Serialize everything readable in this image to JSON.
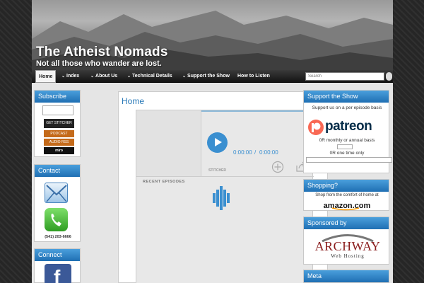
{
  "header": {
    "title": "The Atheist Nomads",
    "tagline": "Not all those who wander are lost."
  },
  "nav": {
    "items": [
      {
        "label": "Home",
        "active": true,
        "dropdown": false
      },
      {
        "label": "Index",
        "active": false,
        "dropdown": true
      },
      {
        "label": "About Us",
        "active": false,
        "dropdown": true
      },
      {
        "label": "Technical Details",
        "active": false,
        "dropdown": true
      },
      {
        "label": "Support the Show",
        "active": false,
        "dropdown": true
      },
      {
        "label": "How to Listen",
        "active": false,
        "dropdown": false
      }
    ],
    "search_placeholder": "Search"
  },
  "left_sidebar": {
    "subscribe_title": "Subscribe",
    "badges": [
      "GET STITCHER",
      "PODCAST",
      "AUDIO RSS",
      "miro"
    ],
    "contact_title": "Contact",
    "phone": "(541) 203-6666",
    "connect_title": "Connect"
  },
  "main": {
    "heading": "Home",
    "player": {
      "time_current": "0:00:00",
      "time_separator": "/",
      "time_total": "0:00:00",
      "brand": "STITCHER",
      "recent_label": "RECENT EPISODES"
    }
  },
  "right_sidebar": {
    "support_title": "Support the Show",
    "support_text": "Support us on a per episode basis",
    "patreon_label": "patreon",
    "or_monthly": "0R monthly or annual basis",
    "or_one_time": "0R one time only",
    "shopping_title": "Shopping?",
    "shopping_text": "Shop from the comfort of home at",
    "amazon_label": "amazon.com",
    "sponsored_title": "Sponsored by",
    "archway_label": "ARCHWAY",
    "archway_sub": "Web Hosting",
    "meta_title": "Meta"
  },
  "colors": {
    "accent_blue": "#2a7ab8",
    "widget_header": "#1f6fb3",
    "patreon": "#f96854",
    "archway": "#8a1c1c"
  }
}
